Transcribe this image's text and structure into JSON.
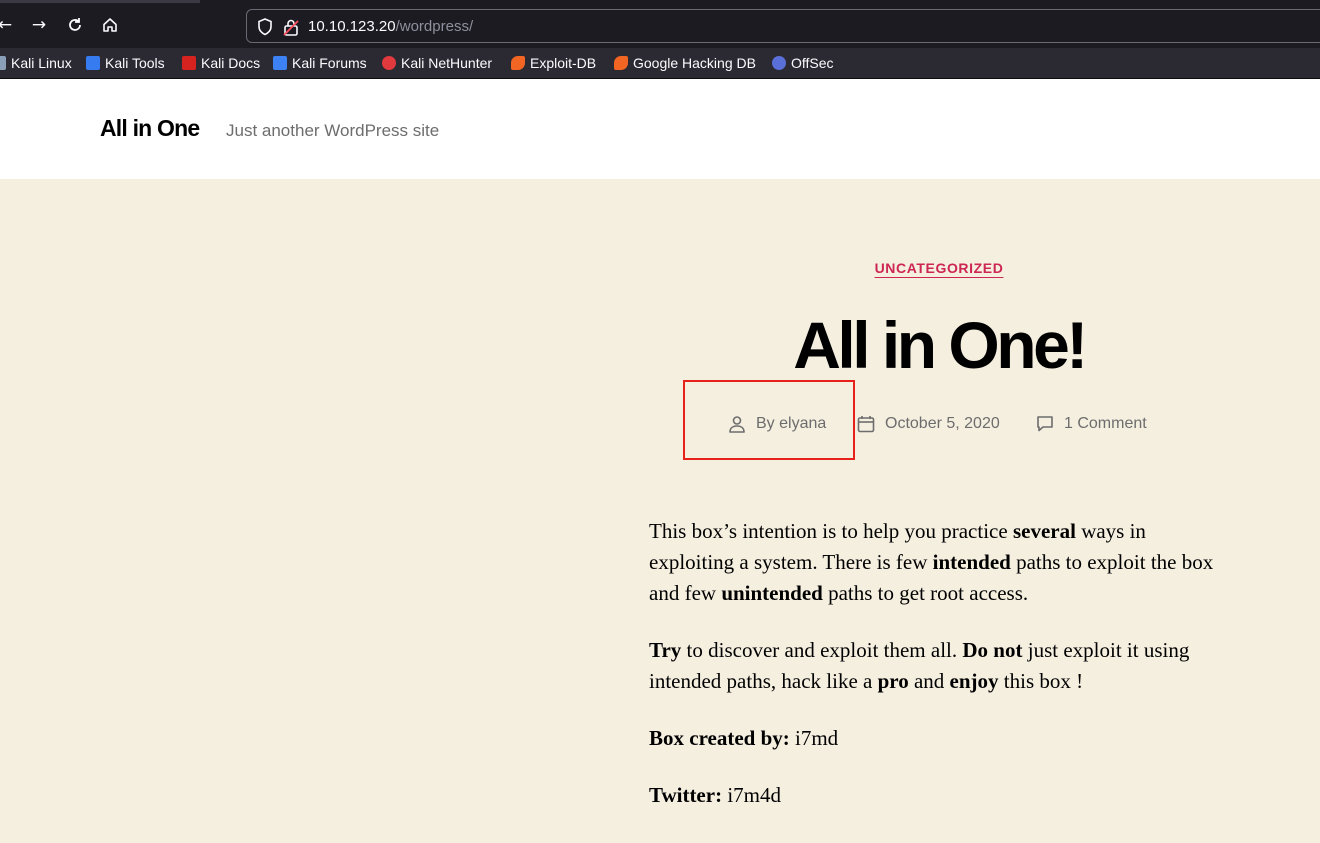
{
  "browser": {
    "url_host": "10.10.123.20",
    "url_path": "/wordpress/",
    "bookmarks": [
      {
        "label": "Kali Linux",
        "icon": "kali-dragon-icon",
        "color": "#8aa0b8"
      },
      {
        "label": "Kali Tools",
        "icon": "kali-tools-icon",
        "color": "#367bf0"
      },
      {
        "label": "Kali Docs",
        "icon": "kali-docs-icon",
        "color": "#d6231f"
      },
      {
        "label": "Kali Forums",
        "icon": "kali-forums-icon",
        "color": "#3d82f5"
      },
      {
        "label": "Kali NetHunter",
        "icon": "kali-nethunter-icon",
        "color": "#e0393e"
      },
      {
        "label": "Exploit-DB",
        "icon": "exploit-db-icon",
        "color": "#f26522"
      },
      {
        "label": "Google Hacking DB",
        "icon": "ghdb-icon",
        "color": "#f26522"
      },
      {
        "label": "OffSec",
        "icon": "offsec-icon",
        "color": "#5b6fd8"
      }
    ]
  },
  "site": {
    "title": "All in One",
    "description": "Just another WordPress site"
  },
  "post": {
    "category": "UNCATEGORIZED",
    "title": "All in One!",
    "author": "By elyana",
    "date": "October 5, 2020",
    "comments": "1 Comment",
    "paragraphs": {
      "p1": {
        "t1": "This box’s intention is to help you practice ",
        "b1": "several",
        "t2": " ways in exploiting a system. There is few ",
        "b2": "intended",
        "t3": " paths to exploit the box and few ",
        "b3": "unintended",
        "t4": " paths to get root access."
      },
      "p2": {
        "b1": "Try",
        "t1": " to discover and exploit them all. ",
        "b2": "Do not",
        "t2": " just exploit it using intended paths, hack like a ",
        "b3": "pro",
        "t3": " and ",
        "b4": "enjoy",
        "t4": " this box !"
      },
      "p3": {
        "b1": "Box created by:",
        "t1": " i7md"
      },
      "p4": {
        "b1": "Twitter:",
        "t1": " i7m4d"
      }
    }
  },
  "colors": {
    "accent": "#cd2653",
    "page_bg": "#f5efe0",
    "annotation": "#e8201a"
  }
}
